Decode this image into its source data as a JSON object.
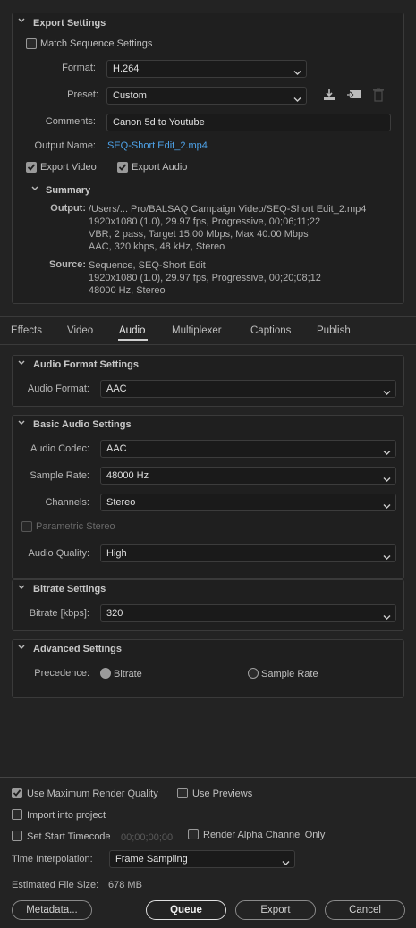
{
  "export_settings": {
    "title": "Export Settings",
    "match_sequence_label": "Match Sequence Settings",
    "match_sequence_checked": false,
    "format_label": "Format:",
    "format_value": "H.264",
    "preset_label": "Preset:",
    "preset_value": "Custom",
    "comments_label": "Comments:",
    "comments_value": "Canon 5d to Youtube",
    "output_name_label": "Output Name:",
    "output_name_value": "SEQ-Short Edit_2.mp4",
    "export_video_label": "Export Video",
    "export_video_checked": true,
    "export_audio_label": "Export Audio",
    "export_audio_checked": true,
    "icons": [
      "save-preset-icon",
      "import-preset-icon",
      "delete-preset-icon"
    ]
  },
  "summary": {
    "title": "Summary",
    "output_label": "Output:",
    "output_lines": [
      "/Users/... Pro/BALSAQ Campaign Video/SEQ-Short Edit_2.mp4",
      "1920x1080 (1.0), 29.97 fps, Progressive, 00;06;11;22",
      "VBR, 2 pass, Target 15.00 Mbps, Max 40.00 Mbps",
      "AAC, 320 kbps, 48 kHz, Stereo"
    ],
    "source_label": "Source:",
    "source_lines": [
      "Sequence, SEQ-Short Edit",
      "1920x1080 (1.0), 29.97 fps, Progressive, 00;20;08;12",
      "48000 Hz, Stereo"
    ]
  },
  "tabs": [
    {
      "label": "Effects",
      "active": false
    },
    {
      "label": "Video",
      "active": false
    },
    {
      "label": "Audio",
      "active": true
    },
    {
      "label": "Multiplexer",
      "active": false
    },
    {
      "label": "Captions",
      "active": false
    },
    {
      "label": "Publish",
      "active": false
    }
  ],
  "audio_format": {
    "title": "Audio Format Settings",
    "format_label": "Audio Format:",
    "format_value": "AAC"
  },
  "basic_audio": {
    "title": "Basic Audio Settings",
    "codec_label": "Audio Codec:",
    "codec_value": "AAC",
    "sample_rate_label": "Sample Rate:",
    "sample_rate_value": "48000 Hz",
    "channels_label": "Channels:",
    "channels_value": "Stereo",
    "parametric_label": "Parametric Stereo",
    "parametric_checked": false,
    "quality_label": "Audio Quality:",
    "quality_value": "High"
  },
  "bitrate": {
    "title": "Bitrate Settings",
    "label": "Bitrate [kbps]:",
    "value": "320"
  },
  "advanced": {
    "title": "Advanced Settings",
    "precedence_label": "Precedence:",
    "option_bitrate": "Bitrate",
    "option_sample_rate": "Sample Rate",
    "selected": "Bitrate"
  },
  "bottom": {
    "max_render_label": "Use Maximum Render Quality",
    "max_render_checked": true,
    "use_previews_label": "Use Previews",
    "use_previews_checked": false,
    "import_label": "Import into project",
    "import_checked": false,
    "start_tc_label": "Set Start Timecode",
    "start_tc_checked": false,
    "start_tc_value": "00;00;00;00",
    "alpha_label": "Render Alpha Channel Only",
    "alpha_checked": false,
    "interp_label": "Time Interpolation:",
    "interp_value": "Frame Sampling",
    "file_size_label": "Estimated File Size:",
    "file_size_value": "678 MB"
  },
  "buttons": {
    "metadata": "Metadata...",
    "queue": "Queue",
    "export": "Export",
    "cancel": "Cancel"
  },
  "colors": {
    "background": "#232323",
    "link": "#4ea3ea",
    "panel_border": "#3a3a3a"
  }
}
